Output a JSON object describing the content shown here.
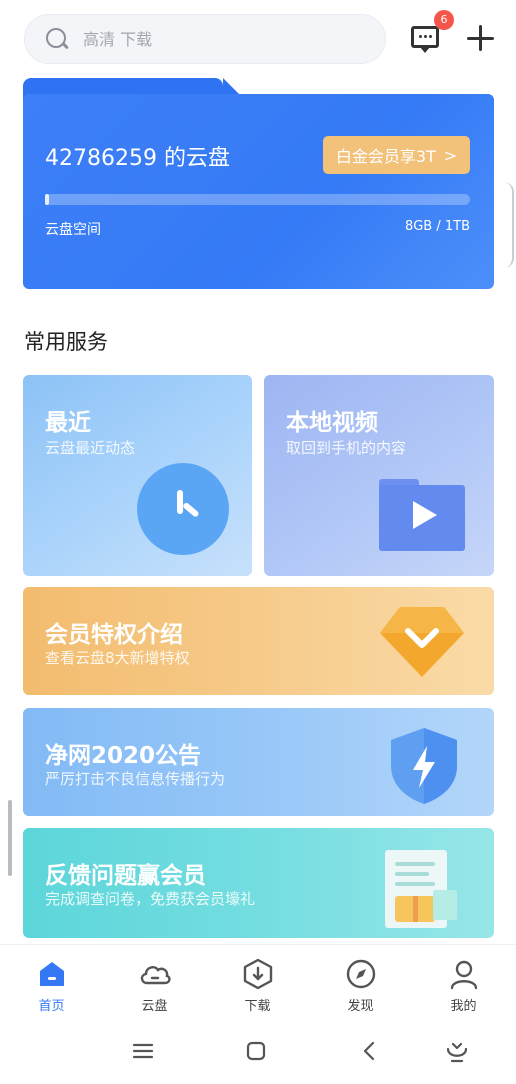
{
  "search": {
    "placeholder": "高清 下载"
  },
  "header": {
    "message_badge": "6"
  },
  "cloud": {
    "title": "42786259 的云盘",
    "vip_button": "白金会员享3T",
    "vip_chevron": ">",
    "space_label": "云盘空间",
    "space_value": "8GB / 1TB",
    "usage_fraction": 0.008
  },
  "services": {
    "section_title": "常用服务",
    "recent": {
      "title": "最近",
      "subtitle": "云盘最近动态"
    },
    "local_video": {
      "title": "本地视频",
      "subtitle": "取回到手机的内容"
    },
    "member": {
      "title": "会员特权介绍",
      "subtitle": "查看云盘8大新增特权"
    },
    "notice": {
      "title": "净网2020公告",
      "subtitle": "严厉打击不良信息传播行为"
    },
    "feedback": {
      "title": "反馈问题赢会员",
      "subtitle": "完成调查问卷，免费获会员壕礼"
    }
  },
  "bottom_nav": {
    "items": [
      {
        "label": "首页",
        "icon": "home-icon",
        "active": true
      },
      {
        "label": "云盘",
        "icon": "cloud-icon",
        "active": false
      },
      {
        "label": "下载",
        "icon": "download-icon",
        "active": false
      },
      {
        "label": "发现",
        "icon": "compass-icon",
        "active": false
      },
      {
        "label": "我的",
        "icon": "person-icon",
        "active": false
      }
    ]
  },
  "colors": {
    "accent": "#3478f6",
    "cloud_card": "#3d7ff7",
    "vip_button": "#f2c17a",
    "badge": "#f4564b"
  }
}
